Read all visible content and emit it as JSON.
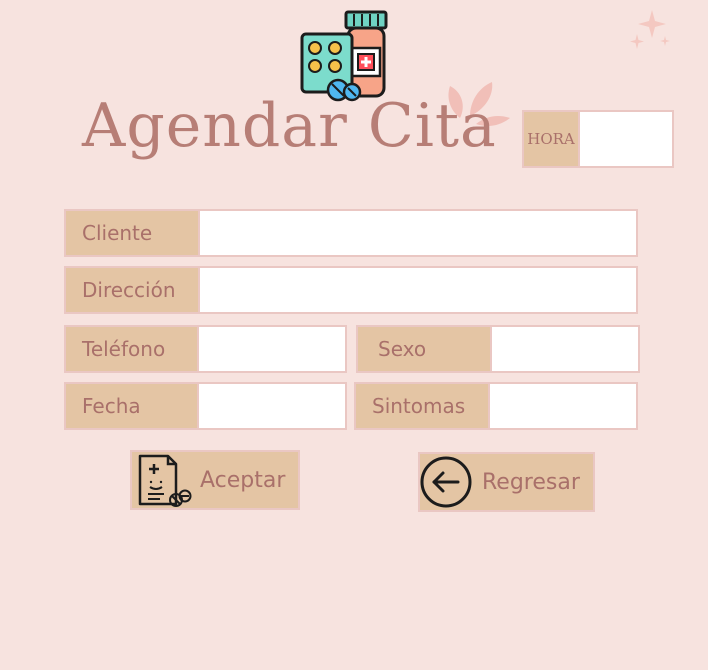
{
  "header": {
    "title": "Agendar Cita",
    "hora_label": "HORA",
    "hora_value": ""
  },
  "form": {
    "cliente": {
      "label": "Cliente",
      "value": ""
    },
    "direccion": {
      "label": "Dirección",
      "value": ""
    },
    "telefono": {
      "label": "Teléfono",
      "value": ""
    },
    "sexo": {
      "label": "Sexo",
      "value": ""
    },
    "fecha": {
      "label": "Fecha",
      "value": ""
    },
    "sintomas": {
      "label": "Sintomas",
      "value": ""
    }
  },
  "actions": {
    "aceptar_label": "Aceptar",
    "regresar_label": "Regresar"
  },
  "icons": {
    "header": "medicine-icon",
    "aceptar": "prescription-icon",
    "regresar": "arrow-left-icon",
    "decor": "sparkle-icon"
  },
  "colors": {
    "background": "#f7e3df",
    "accent": "#b77e76",
    "label_bg": "#e4c5a4",
    "label_text": "#a9706a"
  }
}
